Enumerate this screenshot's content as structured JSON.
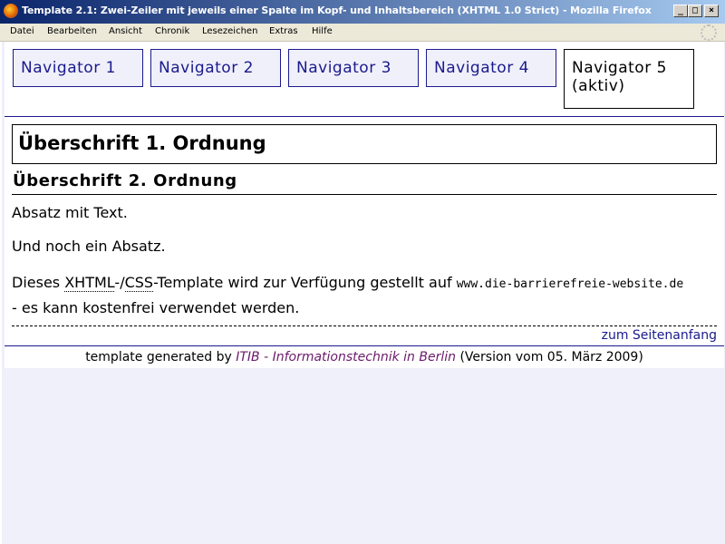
{
  "window": {
    "title": "Template 2.1: Zwei-Zeiler mit jeweils einer Spalte im Kopf- und Inhaltsbereich (XHTML 1.0 Strict) - Mozilla Firefox",
    "minimize": "_",
    "maximize": "□",
    "close": "×"
  },
  "menubar": {
    "items": [
      "Datei",
      "Bearbeiten",
      "Ansicht",
      "Chronik",
      "Lesezeichen",
      "Extras",
      "Hilfe"
    ]
  },
  "nav": {
    "items": [
      "Navigator 1",
      "Navigator 2",
      "Navigator 3",
      "Navigator 4"
    ],
    "active_line1": "Navigator 5",
    "active_line2": "(aktiv)"
  },
  "main": {
    "h1": "Überschrift 1. Ordnung",
    "h2": "Überschrift 2. Ordnung",
    "p1": "Absatz mit Text.",
    "p2": "Und noch ein Absatz.",
    "p3_pre": "Dieses ",
    "p3_abbr1": "XHTML",
    "p3_sep": "-/",
    "p3_abbr2": "CSS",
    "p3_mid": "-Template wird zur Verfügung gestellt auf ",
    "p3_url": "www.die-barrierefreie-website.de",
    "p3_post": " - es kann kostenfrei verwendet werden.",
    "toplink": "zum Seitenanfang"
  },
  "footer": {
    "pre": "template generated by ",
    "link": "ITIB - Informationstechnik in Berlin",
    "post": " (Version vom 05. März 2009)"
  },
  "colors": {
    "nav_border": "#1a1a8c",
    "nav_bg": "#f0f0fb",
    "footer_link": "#6b1a6b"
  }
}
